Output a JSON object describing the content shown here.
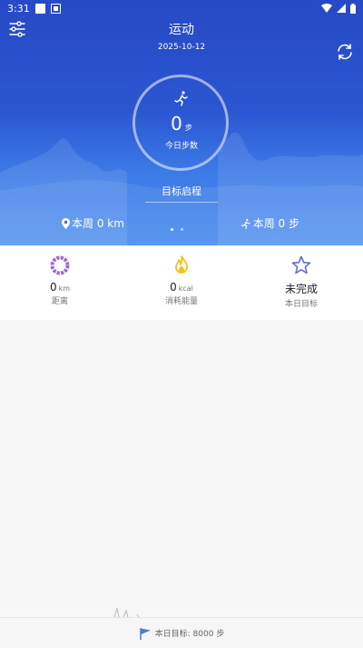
{
  "status": {
    "time": "3:31"
  },
  "header": {
    "title": "运动",
    "date": "2025-10-12"
  },
  "steps": {
    "value": "0",
    "unit": "步",
    "label": "今日步数"
  },
  "goal_journey": "目标启程",
  "week": {
    "distance": "本周 0 km",
    "steps": "本周 0 步"
  },
  "pager": {
    "count": 2,
    "active": 0
  },
  "stats": [
    {
      "value": "0",
      "unit": "km",
      "label": "距离",
      "icon": "distance-ring-icon",
      "color": "#9b6ad6"
    },
    {
      "value": "0",
      "unit": "kcal",
      "label": "消耗能量",
      "icon": "flame-icon",
      "color": "#f2c21b"
    },
    {
      "value": "未完成",
      "unit": "",
      "label": "本日目标",
      "icon": "star-outline-icon",
      "color": "#5a6fd0"
    }
  ],
  "footer": {
    "goal_text": "本日目标: 8000 步"
  },
  "colors": {
    "hero_top": "#2749c5",
    "hero_bottom": "#4b8ef0",
    "flag": "#4a7fd4"
  }
}
